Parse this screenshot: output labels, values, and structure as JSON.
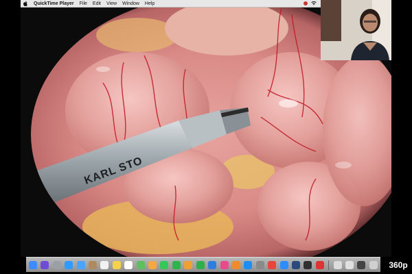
{
  "menubar": {
    "app_name": "QuickTime Player",
    "menus": [
      "File",
      "Edit",
      "View",
      "Window",
      "Help"
    ],
    "icons": [
      "apple-icon",
      "record-icon",
      "wifi-icon"
    ]
  },
  "video": {
    "instrument_text": "KARL STO",
    "scene": "laparoscopic-view"
  },
  "webcam": {
    "icon": "webcam-feed"
  },
  "dock": {
    "apps": [
      {
        "name": "finder",
        "color": "#3d8bfd"
      },
      {
        "name": "siri",
        "color": "#6e4bd8"
      },
      {
        "name": "launchpad",
        "color": "#9aa0a6"
      },
      {
        "name": "safari",
        "color": "#2f9bff"
      },
      {
        "name": "mail",
        "color": "#4aa3ff"
      },
      {
        "name": "contacts",
        "color": "#b08a5a"
      },
      {
        "name": "calendar",
        "color": "#f2f2f2"
      },
      {
        "name": "notes",
        "color": "#f6d24a"
      },
      {
        "name": "reminders",
        "color": "#ffffff"
      },
      {
        "name": "maps",
        "color": "#5fbf5f"
      },
      {
        "name": "photos",
        "color": "#f5a742"
      },
      {
        "name": "messages",
        "color": "#34c759"
      },
      {
        "name": "facetime",
        "color": "#30b34a"
      },
      {
        "name": "pages",
        "color": "#f0a030"
      },
      {
        "name": "numbers",
        "color": "#2eaf4a"
      },
      {
        "name": "keynote",
        "color": "#2f7de1"
      },
      {
        "name": "itunes",
        "color": "#e94a8a"
      },
      {
        "name": "books",
        "color": "#f18a2b"
      },
      {
        "name": "app-store",
        "color": "#1f8ef1"
      },
      {
        "name": "system-preferences",
        "color": "#8a8a8a"
      },
      {
        "name": "chrome",
        "color": "#e8453c"
      },
      {
        "name": "zoom",
        "color": "#2d8cff"
      },
      {
        "name": "quicktime",
        "color": "#2a4a7a"
      },
      {
        "name": "obs",
        "color": "#303030"
      },
      {
        "name": "screenshot",
        "color": "#d33"
      },
      {
        "name": "preview",
        "color": "#dcdcdc"
      },
      {
        "name": "documents",
        "color": "#e0e0e0"
      },
      {
        "name": "downloads",
        "color": "#444"
      },
      {
        "name": "trash",
        "color": "#d0d0d0"
      }
    ]
  },
  "player": {
    "quality_label": "360p"
  }
}
